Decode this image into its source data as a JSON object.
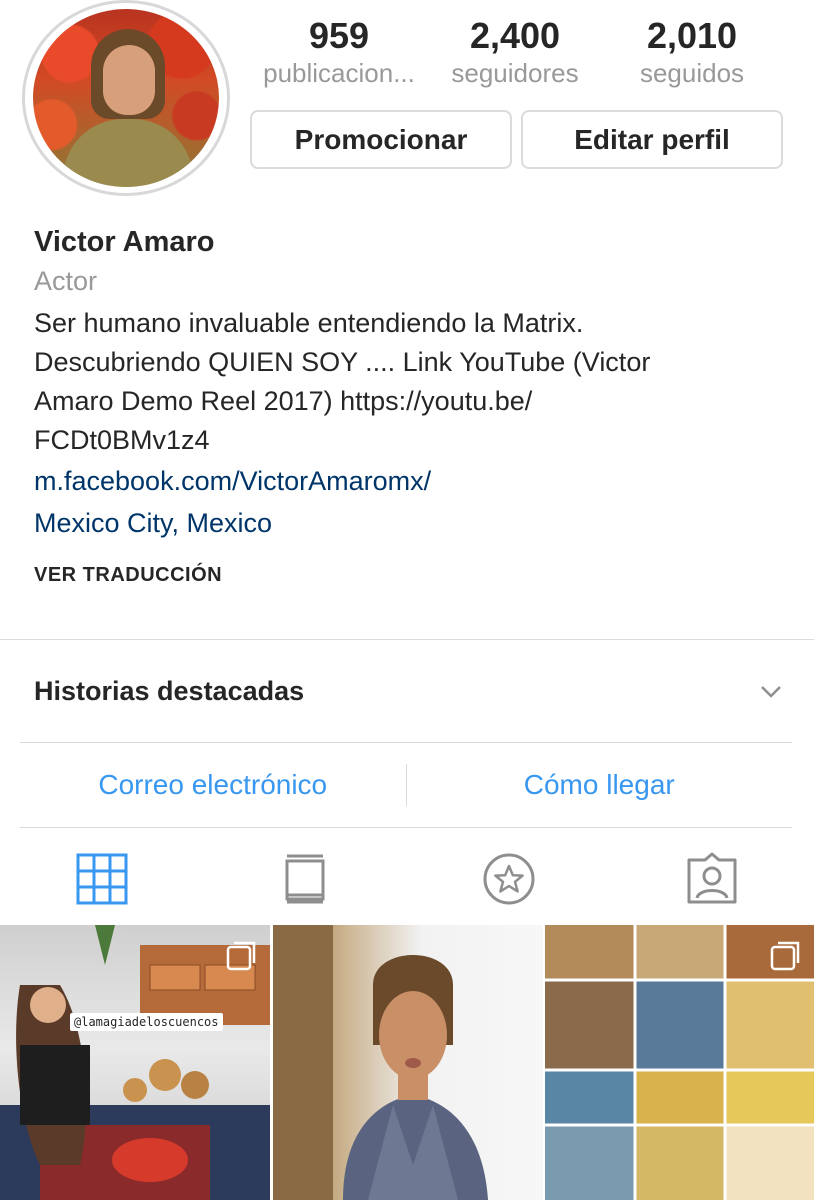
{
  "profile": {
    "stats": {
      "posts": {
        "value": "959",
        "label": "publicacion..."
      },
      "followers": {
        "value": "2,400",
        "label": "seguidores"
      },
      "following": {
        "value": "2,010",
        "label": "seguidos"
      }
    },
    "buttons": {
      "promote": "Promocionar",
      "edit": "Editar perfil"
    },
    "name": "Victor Amaro",
    "category": "Actor",
    "bio_lines": [
      "Ser humano invaluable entendiendo la Matrix.",
      "Descubriendo QUIEN SOY .... Link YouTube (Victor",
      "Amaro Demo Reel 2017) https://youtu.be/",
      "FCDt0BMv1z4"
    ],
    "website": "m.facebook.com/VictorAmaromx/",
    "location": "Mexico City, Mexico",
    "translate_label": "VER TRADUCCIÓN"
  },
  "highlights": {
    "title": "Historias destacadas",
    "icon": "chevron-down-icon"
  },
  "contact": {
    "email": "Correo electrónico",
    "directions": "Cómo llegar"
  },
  "tabs": [
    {
      "name": "grid",
      "icon": "grid-icon",
      "active": true
    },
    {
      "name": "igtv",
      "icon": "tv-icon",
      "active": false
    },
    {
      "name": "saved",
      "icon": "star-icon",
      "active": false
    },
    {
      "name": "tagged",
      "icon": "tagged-icon",
      "active": false
    }
  ],
  "posts": [
    {
      "tag": "@lamagiadeloscuencos",
      "multi": true
    },
    {
      "multi": false
    },
    {
      "multi": true
    }
  ],
  "colors": {
    "text": "#262626",
    "muted": "#999999",
    "link": "#003569",
    "accent": "#3897f0",
    "border": "#dbdbdb"
  }
}
